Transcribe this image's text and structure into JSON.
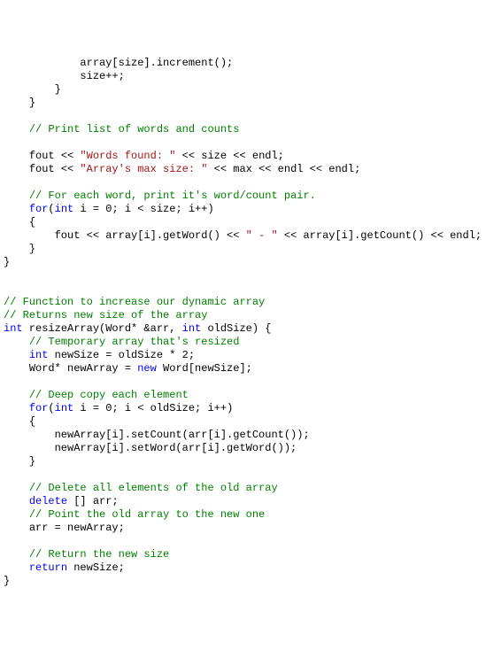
{
  "lines": [
    {
      "indent": "            ",
      "spans": [
        {
          "t": "array[size].increment();",
          "c": "c-text"
        }
      ]
    },
    {
      "indent": "            ",
      "spans": [
        {
          "t": "size++;",
          "c": "c-text"
        }
      ]
    },
    {
      "indent": "        ",
      "spans": [
        {
          "t": "}",
          "c": "c-text"
        }
      ]
    },
    {
      "indent": "    ",
      "spans": [
        {
          "t": "}",
          "c": "c-text"
        }
      ]
    },
    {
      "indent": "",
      "spans": [
        {
          "t": "",
          "c": "c-text"
        }
      ]
    },
    {
      "indent": "    ",
      "spans": [
        {
          "t": "// Print list of words and counts",
          "c": "c-com"
        }
      ]
    },
    {
      "indent": "",
      "spans": [
        {
          "t": "",
          "c": "c-text"
        }
      ]
    },
    {
      "indent": "    ",
      "spans": [
        {
          "t": "fout << ",
          "c": "c-text"
        },
        {
          "t": "\"Words found: \"",
          "c": "c-str"
        },
        {
          "t": " << size << endl;",
          "c": "c-text"
        }
      ]
    },
    {
      "indent": "    ",
      "spans": [
        {
          "t": "fout << ",
          "c": "c-text"
        },
        {
          "t": "\"Array's max size: \"",
          "c": "c-str"
        },
        {
          "t": " << max << endl << endl;",
          "c": "c-text"
        }
      ]
    },
    {
      "indent": "",
      "spans": [
        {
          "t": "",
          "c": "c-text"
        }
      ]
    },
    {
      "indent": "    ",
      "spans": [
        {
          "t": "// For each word, print it's word/count pair.",
          "c": "c-com"
        }
      ]
    },
    {
      "indent": "    ",
      "spans": [
        {
          "t": "for",
          "c": "c-kw"
        },
        {
          "t": "(",
          "c": "c-text"
        },
        {
          "t": "int",
          "c": "c-kw"
        },
        {
          "t": " i = 0; i < size; i++)",
          "c": "c-text"
        }
      ]
    },
    {
      "indent": "    ",
      "spans": [
        {
          "t": "{",
          "c": "c-text"
        }
      ]
    },
    {
      "indent": "        ",
      "spans": [
        {
          "t": "fout << array[i].getWord() << ",
          "c": "c-text"
        },
        {
          "t": "\" - \"",
          "c": "c-str"
        },
        {
          "t": " << array[i].getCount() << endl;",
          "c": "c-text"
        }
      ]
    },
    {
      "indent": "    ",
      "spans": [
        {
          "t": "}",
          "c": "c-text"
        }
      ]
    },
    {
      "indent": "",
      "spans": [
        {
          "t": "}",
          "c": "c-text"
        }
      ]
    },
    {
      "indent": "",
      "spans": [
        {
          "t": "",
          "c": "c-text"
        }
      ]
    },
    {
      "indent": "",
      "spans": [
        {
          "t": "",
          "c": "c-text"
        }
      ]
    },
    {
      "indent": "",
      "spans": [
        {
          "t": "// Function to increase our dynamic array",
          "c": "c-com"
        }
      ]
    },
    {
      "indent": "",
      "spans": [
        {
          "t": "// Returns new size of the array",
          "c": "c-com"
        }
      ]
    },
    {
      "indent": "",
      "spans": [
        {
          "t": "int",
          "c": "c-kw"
        },
        {
          "t": " resizeArray(Word* &arr, ",
          "c": "c-text"
        },
        {
          "t": "int",
          "c": "c-kw"
        },
        {
          "t": " oldSize) {",
          "c": "c-text"
        }
      ]
    },
    {
      "indent": "    ",
      "spans": [
        {
          "t": "// Temporary array that's resized",
          "c": "c-com"
        }
      ]
    },
    {
      "indent": "    ",
      "spans": [
        {
          "t": "int",
          "c": "c-kw"
        },
        {
          "t": " newSize = oldSize * 2;",
          "c": "c-text"
        }
      ]
    },
    {
      "indent": "    ",
      "spans": [
        {
          "t": "Word* newArray = ",
          "c": "c-text"
        },
        {
          "t": "new",
          "c": "c-kw"
        },
        {
          "t": " Word[newSize];",
          "c": "c-text"
        }
      ]
    },
    {
      "indent": "",
      "spans": [
        {
          "t": "",
          "c": "c-text"
        }
      ]
    },
    {
      "indent": "    ",
      "spans": [
        {
          "t": "// Deep copy each element",
          "c": "c-com"
        }
      ]
    },
    {
      "indent": "    ",
      "spans": [
        {
          "t": "for",
          "c": "c-kw"
        },
        {
          "t": "(",
          "c": "c-text"
        },
        {
          "t": "int",
          "c": "c-kw"
        },
        {
          "t": " i = 0; i < oldSize; i++)",
          "c": "c-text"
        }
      ]
    },
    {
      "indent": "    ",
      "spans": [
        {
          "t": "{",
          "c": "c-text"
        }
      ]
    },
    {
      "indent": "        ",
      "spans": [
        {
          "t": "newArray[i].setCount(arr[i].getCount());",
          "c": "c-text"
        }
      ]
    },
    {
      "indent": "        ",
      "spans": [
        {
          "t": "newArray[i].setWord(arr[i].getWord());",
          "c": "c-text"
        }
      ]
    },
    {
      "indent": "    ",
      "spans": [
        {
          "t": "}",
          "c": "c-text"
        }
      ]
    },
    {
      "indent": "",
      "spans": [
        {
          "t": "",
          "c": "c-text"
        }
      ]
    },
    {
      "indent": "    ",
      "spans": [
        {
          "t": "// Delete all elements of the old array",
          "c": "c-com"
        }
      ]
    },
    {
      "indent": "    ",
      "spans": [
        {
          "t": "delete",
          "c": "c-kw"
        },
        {
          "t": " [] arr;",
          "c": "c-text"
        }
      ]
    },
    {
      "indent": "    ",
      "spans": [
        {
          "t": "// Point the old array to the new one",
          "c": "c-com"
        }
      ]
    },
    {
      "indent": "    ",
      "spans": [
        {
          "t": "arr = newArray;",
          "c": "c-text"
        }
      ]
    },
    {
      "indent": "",
      "spans": [
        {
          "t": "",
          "c": "c-text"
        }
      ]
    },
    {
      "indent": "    ",
      "spans": [
        {
          "t": "// Return the new size",
          "c": "c-com"
        }
      ]
    },
    {
      "indent": "    ",
      "spans": [
        {
          "t": "return",
          "c": "c-kw"
        },
        {
          "t": " newSize;",
          "c": "c-text"
        }
      ]
    },
    {
      "indent": "",
      "spans": [
        {
          "t": "}",
          "c": "c-text"
        }
      ]
    }
  ]
}
